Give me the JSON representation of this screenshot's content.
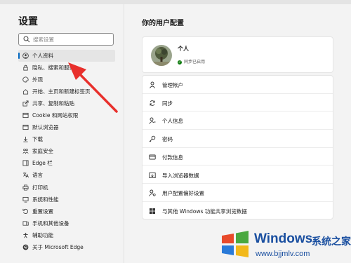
{
  "sidebar": {
    "title": "设置",
    "search_placeholder": "搜索设置",
    "items": [
      {
        "label": "个人资料",
        "icon": "profile-icon"
      },
      {
        "label": "隐私、搜索和服务",
        "icon": "lock-icon"
      },
      {
        "label": "外观",
        "icon": "palette-icon"
      },
      {
        "label": "开始、主页和新建标签页",
        "icon": "home-icon"
      },
      {
        "label": "共享、复制和粘贴",
        "icon": "share-icon"
      },
      {
        "label": "Cookie 和网站权限",
        "icon": "site-permissions-icon"
      },
      {
        "label": "默认浏览器",
        "icon": "browser-icon"
      },
      {
        "label": "下载",
        "icon": "download-icon"
      },
      {
        "label": "家庭安全",
        "icon": "family-icon"
      },
      {
        "label": "Edge 栏",
        "icon": "edge-bar-icon"
      },
      {
        "label": "语言",
        "icon": "language-icon"
      },
      {
        "label": "打印机",
        "icon": "printer-icon"
      },
      {
        "label": "系统和性能",
        "icon": "system-icon"
      },
      {
        "label": "重置设置",
        "icon": "reset-icon"
      },
      {
        "label": "手机和其他设备",
        "icon": "phone-icon"
      },
      {
        "label": "辅助功能",
        "icon": "accessibility-icon"
      },
      {
        "label": "关于 Microsoft Edge",
        "icon": "edge-logo-icon"
      }
    ]
  },
  "main": {
    "title": "你的用户配置",
    "profile": {
      "name": "个人",
      "sync_status": "同步已启用"
    },
    "menu": [
      {
        "label": "管理帐户",
        "icon": "person-icon"
      },
      {
        "label": "同步",
        "icon": "sync-icon"
      },
      {
        "label": "个人信息",
        "icon": "person-info-icon"
      },
      {
        "label": "密码",
        "icon": "key-icon"
      },
      {
        "label": "付款信息",
        "icon": "card-icon"
      },
      {
        "label": "导入浏览器数据",
        "icon": "import-icon"
      },
      {
        "label": "用户配置偏好设置",
        "icon": "profile-prefs-icon"
      },
      {
        "label": "与其他 Windows 功能共享浏览数据",
        "icon": "windows-icon"
      }
    ]
  },
  "watermark": {
    "brand": "Windows",
    "suffix": "系统之家",
    "url": "www.bjjmlv.com"
  },
  "colors": {
    "accent": "#0067c0",
    "annotation_arrow": "#e8302c",
    "sync_ok": "#107c10"
  }
}
